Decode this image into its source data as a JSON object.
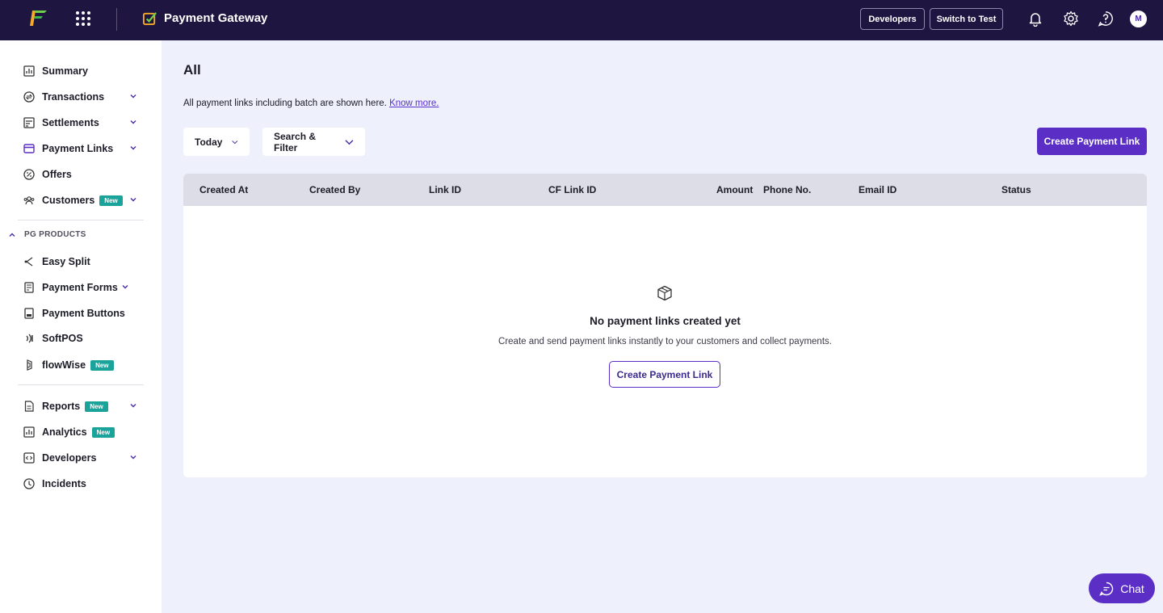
{
  "header": {
    "product_name": "Payment Gateway",
    "developers_label": "Developers",
    "switch_label": "Switch to Test",
    "avatar_initial": "M"
  },
  "sidebar": {
    "items": [
      {
        "label": "Summary",
        "icon": "summary-icon"
      },
      {
        "label": "Transactions",
        "icon": "transactions-icon",
        "expandable": true
      },
      {
        "label": "Settlements",
        "icon": "settlements-icon",
        "expandable": true
      },
      {
        "label": "Payment Links",
        "icon": "payment-links-icon",
        "expandable": true,
        "active": true
      },
      {
        "label": "Offers",
        "icon": "offers-icon"
      },
      {
        "label": "Customers",
        "icon": "customers-icon",
        "badge": "New",
        "expandable": true
      }
    ],
    "section_title": "PG PRODUCTS",
    "products": [
      {
        "label": "Easy Split",
        "icon": "easy-split-icon"
      },
      {
        "label": "Payment Forms",
        "icon": "payment-forms-icon",
        "expandable": true
      },
      {
        "label": "Payment Buttons",
        "icon": "payment-buttons-icon"
      },
      {
        "label": "SoftPOS",
        "icon": "softpos-icon"
      },
      {
        "label": "flowWise",
        "icon": "flowwise-icon",
        "badge": "New"
      }
    ],
    "bottom": [
      {
        "label": "Reports",
        "icon": "reports-icon",
        "badge": "New",
        "expandable": true
      },
      {
        "label": "Analytics",
        "icon": "analytics-icon",
        "badge": "New"
      },
      {
        "label": "Developers",
        "icon": "developers-icon",
        "expandable": true
      },
      {
        "label": "Incidents",
        "icon": "incidents-icon"
      }
    ]
  },
  "main": {
    "title": "All",
    "subtitle": "All payment links including batch are shown here.",
    "know_more": "Know more.",
    "filter_date": "Today",
    "filter_search": "Search & Filter",
    "create_label": "Create Payment Link",
    "columns": [
      "Created At",
      "Created By",
      "Link ID",
      "CF Link ID",
      "Amount",
      "Phone No.",
      "Email ID",
      "Status"
    ],
    "empty_title": "No payment links created yet",
    "empty_desc": "Create and send payment links instantly to your customers and collect payments.",
    "empty_button": "Create Payment Link"
  },
  "chat_label": "Chat",
  "colors": {
    "topbar": "#1e1540",
    "accent": "#5b2ec6",
    "badge": "#1aa39a",
    "background": "#eef0fb"
  }
}
